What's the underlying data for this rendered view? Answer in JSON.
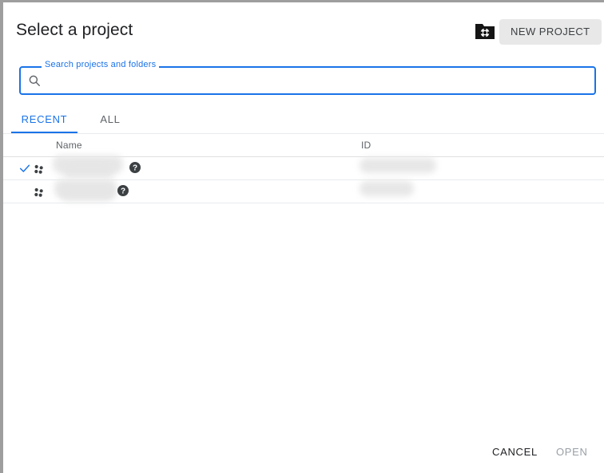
{
  "dialog": {
    "title": "Select a project"
  },
  "header": {
    "folder_icon_name": "folder-special-icon",
    "new_project_label": "NEW PROJECT"
  },
  "search": {
    "label": "Search projects and folders",
    "value": "",
    "placeholder": "",
    "icon_name": "search-icon"
  },
  "tabs": {
    "items": [
      {
        "label": "RECENT",
        "active": true
      },
      {
        "label": "ALL",
        "active": false
      }
    ]
  },
  "table": {
    "columns": [
      {
        "key": "name",
        "label": "Name"
      },
      {
        "key": "id",
        "label": "ID"
      }
    ],
    "rows": [
      {
        "selected": true,
        "icon_name": "project-icon",
        "name": "",
        "name_redacted": true,
        "id": "",
        "id_redacted": true,
        "help_icon_name": "help-icon"
      },
      {
        "selected": false,
        "icon_name": "project-icon",
        "name": "",
        "name_redacted": true,
        "id": "",
        "id_redacted": true,
        "help_icon_name": "help-icon"
      }
    ]
  },
  "footer": {
    "cancel_label": "CANCEL",
    "open_label": "OPEN",
    "open_disabled": true
  },
  "colors": {
    "accent": "#1a73e8",
    "text_primary": "#202124",
    "text_secondary": "#5f6368",
    "text_disabled": "#9aa0a6",
    "button_bg": "#e8e8e8",
    "divider": "#e8eaed",
    "window_border": "#9e9e9e"
  }
}
